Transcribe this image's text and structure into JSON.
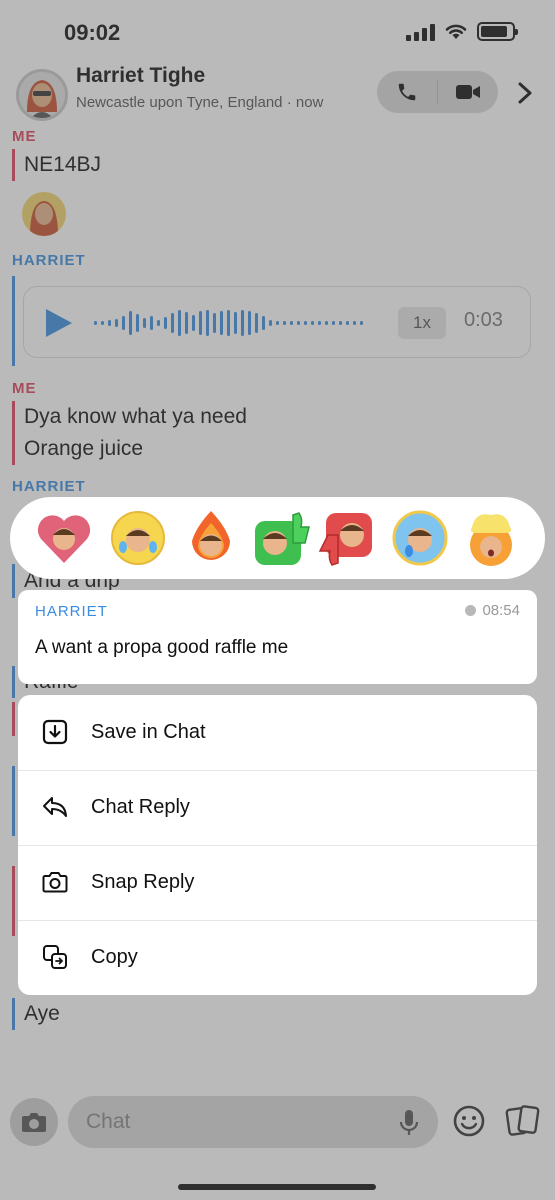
{
  "status_bar": {
    "time": "09:02"
  },
  "header": {
    "name": "Harriet Tighe",
    "subtitle": "Newcastle upon Tyne, England · now"
  },
  "chat": {
    "me_label": "ME",
    "harriet_label": "HARRIET",
    "message_postcode": "NE14BJ",
    "voice_note": {
      "speed": "1x",
      "duration": "0:03"
    },
    "message_line1": "Dya know what ya need",
    "message_line2": "Orange juice",
    "partial_msg_1": "And a drip",
    "partial_msg_2": "Raffle",
    "last_message": "Aye"
  },
  "reactions": [
    "heart-bitmoji",
    "laughing-tears-bitmoji",
    "fire-bitmoji",
    "thumbs-up-bitmoji",
    "thumbs-down-bitmoji",
    "sad-tear-bitmoji",
    "mind-blown-bitmoji"
  ],
  "focused_message": {
    "sender": "HARRIET",
    "time": "08:54",
    "text": "A want a propa good raffle me"
  },
  "menu": {
    "save": "Save in Chat",
    "chat_reply": "Chat Reply",
    "snap_reply": "Snap Reply",
    "copy": "Copy"
  },
  "input": {
    "placeholder": "Chat"
  },
  "colors": {
    "me": "#e0425c",
    "harriet": "#3a8de0",
    "overlay": "#5a5a5a"
  }
}
